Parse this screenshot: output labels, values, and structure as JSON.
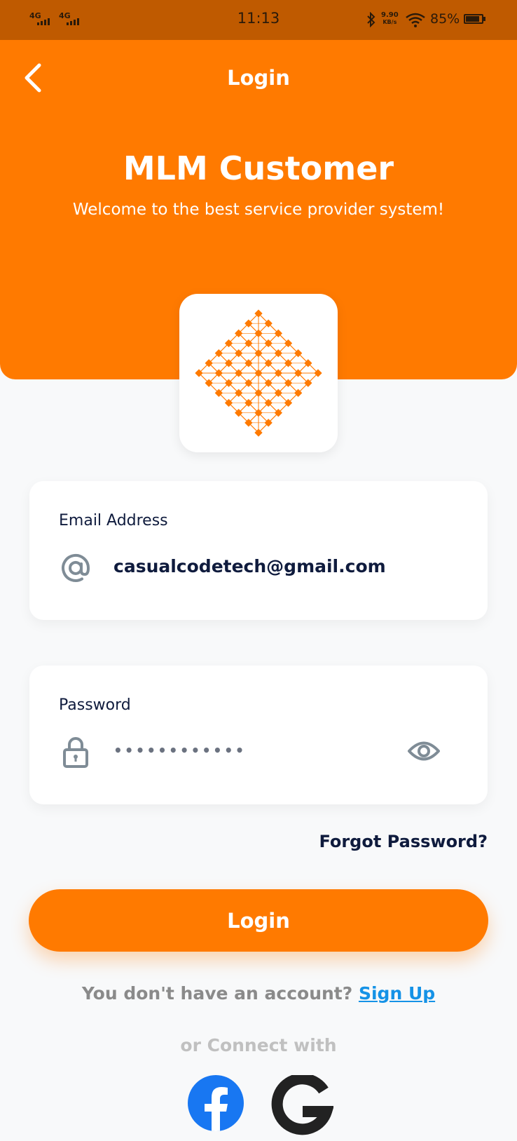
{
  "status_bar": {
    "network_1": "4G",
    "network_2": "4G",
    "time": "11:13",
    "speed_value": "9.90",
    "speed_unit": "KB/s",
    "battery": "85%"
  },
  "header": {
    "title": "Login",
    "app_name": "MLM Customer",
    "tagline": "Welcome to the best service provider system!"
  },
  "email_field": {
    "label": "Email Address",
    "value": "casualcodetech@gmail.com",
    "icon": "at-icon"
  },
  "password_field": {
    "label": "Password",
    "value": "••••••••••••",
    "icon": "lock-icon",
    "toggle_icon": "eye-icon"
  },
  "forgot_password": "Forgot Password?",
  "login_button": "Login",
  "signup": {
    "prompt": "You don't have an account?",
    "link": "Sign Up"
  },
  "connect_text": "or Connect with",
  "social": [
    "facebook-icon",
    "google-icon"
  ],
  "colors": {
    "primary": "#ff7a00",
    "status_bar": "#bf5a00",
    "link": "#1592e6",
    "text_dark": "#0f1b3d",
    "icon_gray": "#7f8c96"
  }
}
